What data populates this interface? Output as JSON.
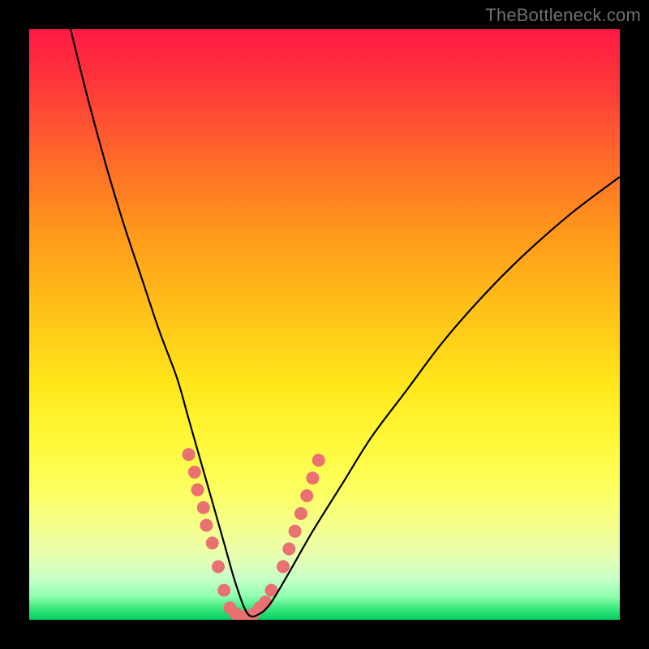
{
  "watermark": "TheBottleneck.com",
  "colors": {
    "frame": "#000000",
    "curve": "#000000",
    "dots": "#e97171",
    "gradient_top": "#ff1a44",
    "gradient_bottom": "#00d060"
  },
  "chart_data": {
    "type": "line",
    "title": "",
    "xlabel": "",
    "ylabel": "",
    "xlim": [
      0,
      100
    ],
    "ylim": [
      0,
      100
    ],
    "grid": false,
    "note": "No axes or ticks rendered; values are percentages of plot area. y=0 at bottom (green), y=100 at top (red). Curve bottoms near x≈36, y≈0.",
    "series": [
      {
        "name": "bottleneck-curve",
        "x": [
          7,
          10,
          13,
          16,
          19,
          22,
          25,
          27,
          29,
          31,
          33,
          35,
          37,
          39,
          41,
          44,
          48,
          53,
          58,
          64,
          70,
          77,
          84,
          92,
          100
        ],
        "y": [
          100,
          88,
          77,
          67,
          58,
          49,
          41,
          34,
          27,
          20,
          13,
          6,
          1,
          1,
          3,
          8,
          15,
          23,
          31,
          39,
          47,
          55,
          62,
          69,
          75
        ]
      }
    ],
    "annotations": {
      "highlight_dots": {
        "description": "Salmon dots clustered around the valley of the curve",
        "points": [
          {
            "x": 27,
            "y": 28
          },
          {
            "x": 28,
            "y": 25
          },
          {
            "x": 28.5,
            "y": 22
          },
          {
            "x": 29.5,
            "y": 19
          },
          {
            "x": 30,
            "y": 16
          },
          {
            "x": 31,
            "y": 13
          },
          {
            "x": 32,
            "y": 9
          },
          {
            "x": 33,
            "y": 5
          },
          {
            "x": 34,
            "y": 2
          },
          {
            "x": 35,
            "y": 1
          },
          {
            "x": 36,
            "y": 0.5
          },
          {
            "x": 37,
            "y": 0.5
          },
          {
            "x": 38,
            "y": 1
          },
          {
            "x": 39,
            "y": 2
          },
          {
            "x": 40,
            "y": 3
          },
          {
            "x": 41,
            "y": 5
          },
          {
            "x": 43,
            "y": 9
          },
          {
            "x": 44,
            "y": 12
          },
          {
            "x": 45,
            "y": 15
          },
          {
            "x": 46,
            "y": 18
          },
          {
            "x": 47,
            "y": 21
          },
          {
            "x": 48,
            "y": 24
          },
          {
            "x": 49,
            "y": 27
          }
        ]
      }
    }
  }
}
